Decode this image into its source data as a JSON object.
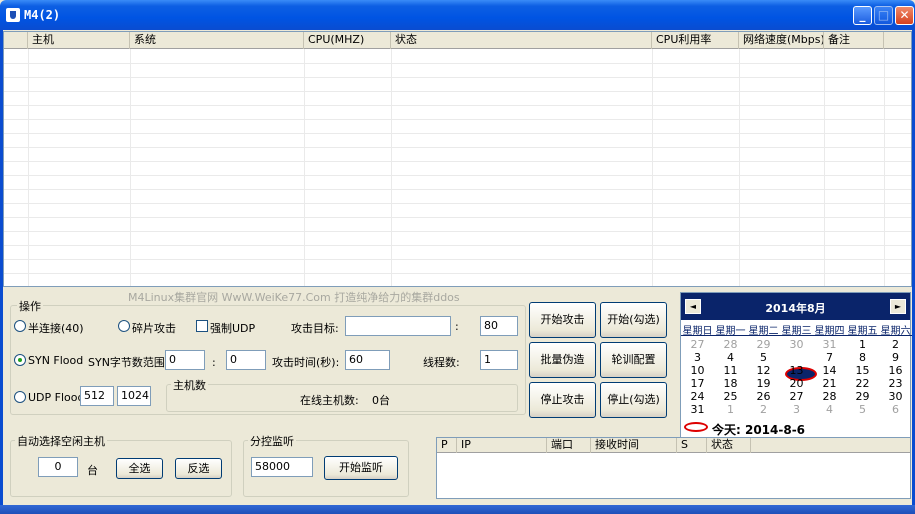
{
  "window": {
    "title": "M4(2)"
  },
  "host_table": {
    "columns": [
      "主机",
      "系统",
      "CPU(MHZ)",
      "状态",
      "CPU利用率",
      "网络速度(Mbps)",
      "备注"
    ]
  },
  "watermark": "M4Linux集群官网 WwW.WeiKe77.Com 打造纯净给力的集群ddos",
  "ops": {
    "group_title": "操作",
    "radio_half": "半连接(40)",
    "radio_frag": "碎片攻击",
    "check_udp": "强制UDP",
    "target_label": "攻击目标:",
    "target_value": "",
    "colon": ":",
    "port_value": "80",
    "radio_syn": "SYN Flood",
    "syn_range_label": "SYN字节数范围",
    "syn_min": "0",
    "syn_sep": ":",
    "syn_max": "0",
    "time_label": "攻击时间(秒):",
    "time_value": "60",
    "threads_label": "线程数:",
    "threads_value": "1",
    "radio_udp": "UDP Flood",
    "udp_min": "512",
    "udp_max": "1024",
    "hosts_group": "主机数",
    "online_label": "在线主机数:",
    "online_value": "0台"
  },
  "buttons": {
    "start_attack": "开始攻击",
    "start_checked": "开始(勾选)",
    "batch_fake": "批量伪造",
    "rotate_config": "轮训配置",
    "stop_attack": "停止攻击",
    "stop_checked": "停止(勾选)"
  },
  "calendar": {
    "title": "2014年8月",
    "prev": "◄",
    "next": "►",
    "weekdays": [
      "星期日",
      "星期一",
      "星期二",
      "星期三",
      "星期四",
      "星期五",
      "星期六"
    ],
    "weeks": [
      [
        "27",
        "28",
        "29",
        "30",
        "31",
        "1",
        "2"
      ],
      [
        "3",
        "4",
        "5",
        "6",
        "7",
        "8",
        "9"
      ],
      [
        "10",
        "11",
        "12",
        "13",
        "14",
        "15",
        "16"
      ],
      [
        "17",
        "18",
        "19",
        "20",
        "21",
        "22",
        "23"
      ],
      [
        "24",
        "25",
        "26",
        "27",
        "28",
        "29",
        "30"
      ],
      [
        "31",
        "1",
        "2",
        "3",
        "4",
        "5",
        "6"
      ]
    ],
    "today_label": "今天: 2014-8-6"
  },
  "auto": {
    "group_title": "自动选择空闲主机",
    "count_value": "0",
    "unit": "台",
    "select_all": "全选",
    "invert": "反选"
  },
  "listen": {
    "group_title": "分控监听",
    "port_value": "58000",
    "start": "开始监听"
  },
  "monitor_table": {
    "columns": [
      "P",
      "IP",
      "端口",
      "接收时间",
      "S",
      "状态"
    ]
  }
}
